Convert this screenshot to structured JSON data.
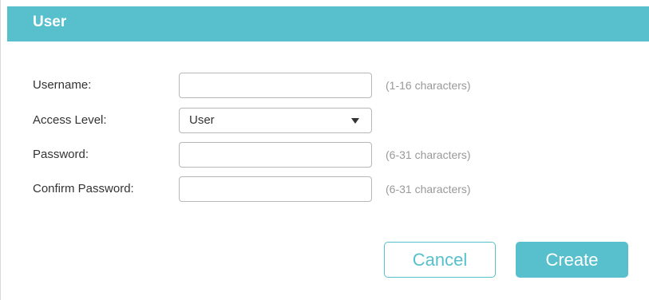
{
  "dialog": {
    "title": "User"
  },
  "form": {
    "username": {
      "label": "Username:",
      "value": "",
      "hint": "(1-16 characters)"
    },
    "access_level": {
      "label": "Access Level:",
      "selected": "User"
    },
    "password": {
      "label": "Password:",
      "value": "",
      "hint": "(6-31 characters)"
    },
    "confirm_password": {
      "label": "Confirm Password:",
      "value": "",
      "hint": "(6-31 characters)"
    }
  },
  "buttons": {
    "cancel_label": "Cancel",
    "create_label": "Create"
  },
  "colors": {
    "accent": "#57c0cc",
    "input_border": "#b7b7b7",
    "hint_text": "#999999",
    "label_text": "#333333"
  },
  "icons": {
    "select_caret": "caret-down-icon"
  }
}
